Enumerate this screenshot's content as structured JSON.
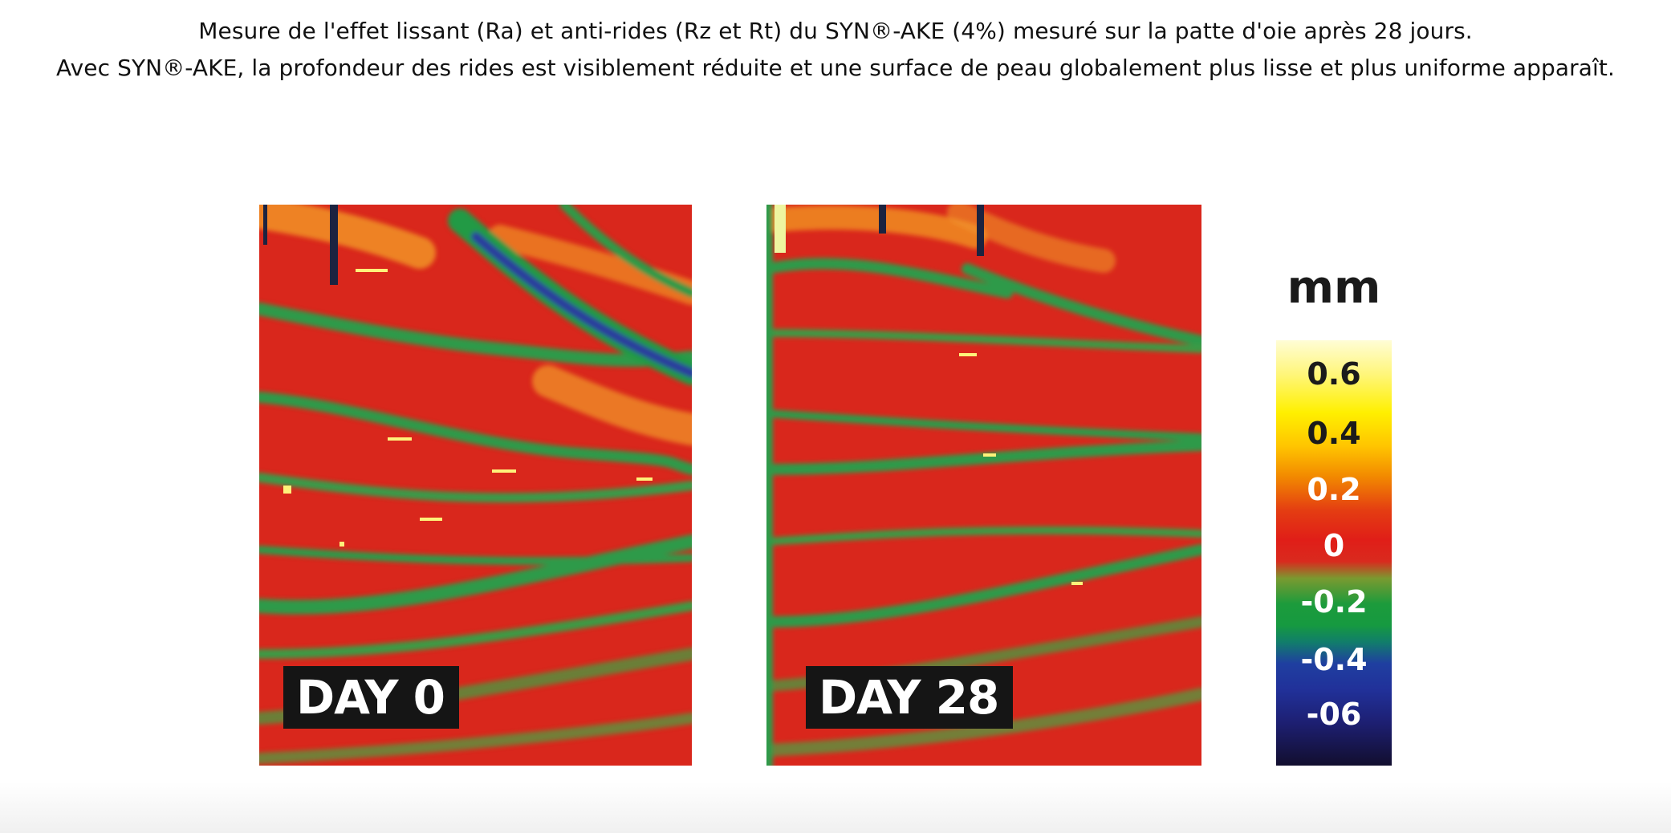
{
  "caption": {
    "line1": "Mesure de l'effet lissant (Ra) et anti-rides (Rz et Rt) du SYN®-AKE (4%) mesuré sur la patte d'oie après 28 jours.",
    "line2": "Avec SYN®-AKE, la profondeur des rides est visiblement réduite et une surface de peau globalement plus lisse et plus uniforme apparaît."
  },
  "panels": [
    {
      "label": "DAY 0"
    },
    {
      "label": "DAY 28"
    }
  ],
  "scale": {
    "unit": "mm",
    "ticks": [
      "0.6",
      "0.4",
      "0.2",
      "0",
      "-0.2",
      "-0.4",
      "-06"
    ]
  },
  "colors": {
    "red": "#d8281e",
    "green": "#2d9a45",
    "blue": "#2538a0",
    "yellow": "#fff000",
    "orange": "#f4a020",
    "label_bg": "#151515"
  }
}
